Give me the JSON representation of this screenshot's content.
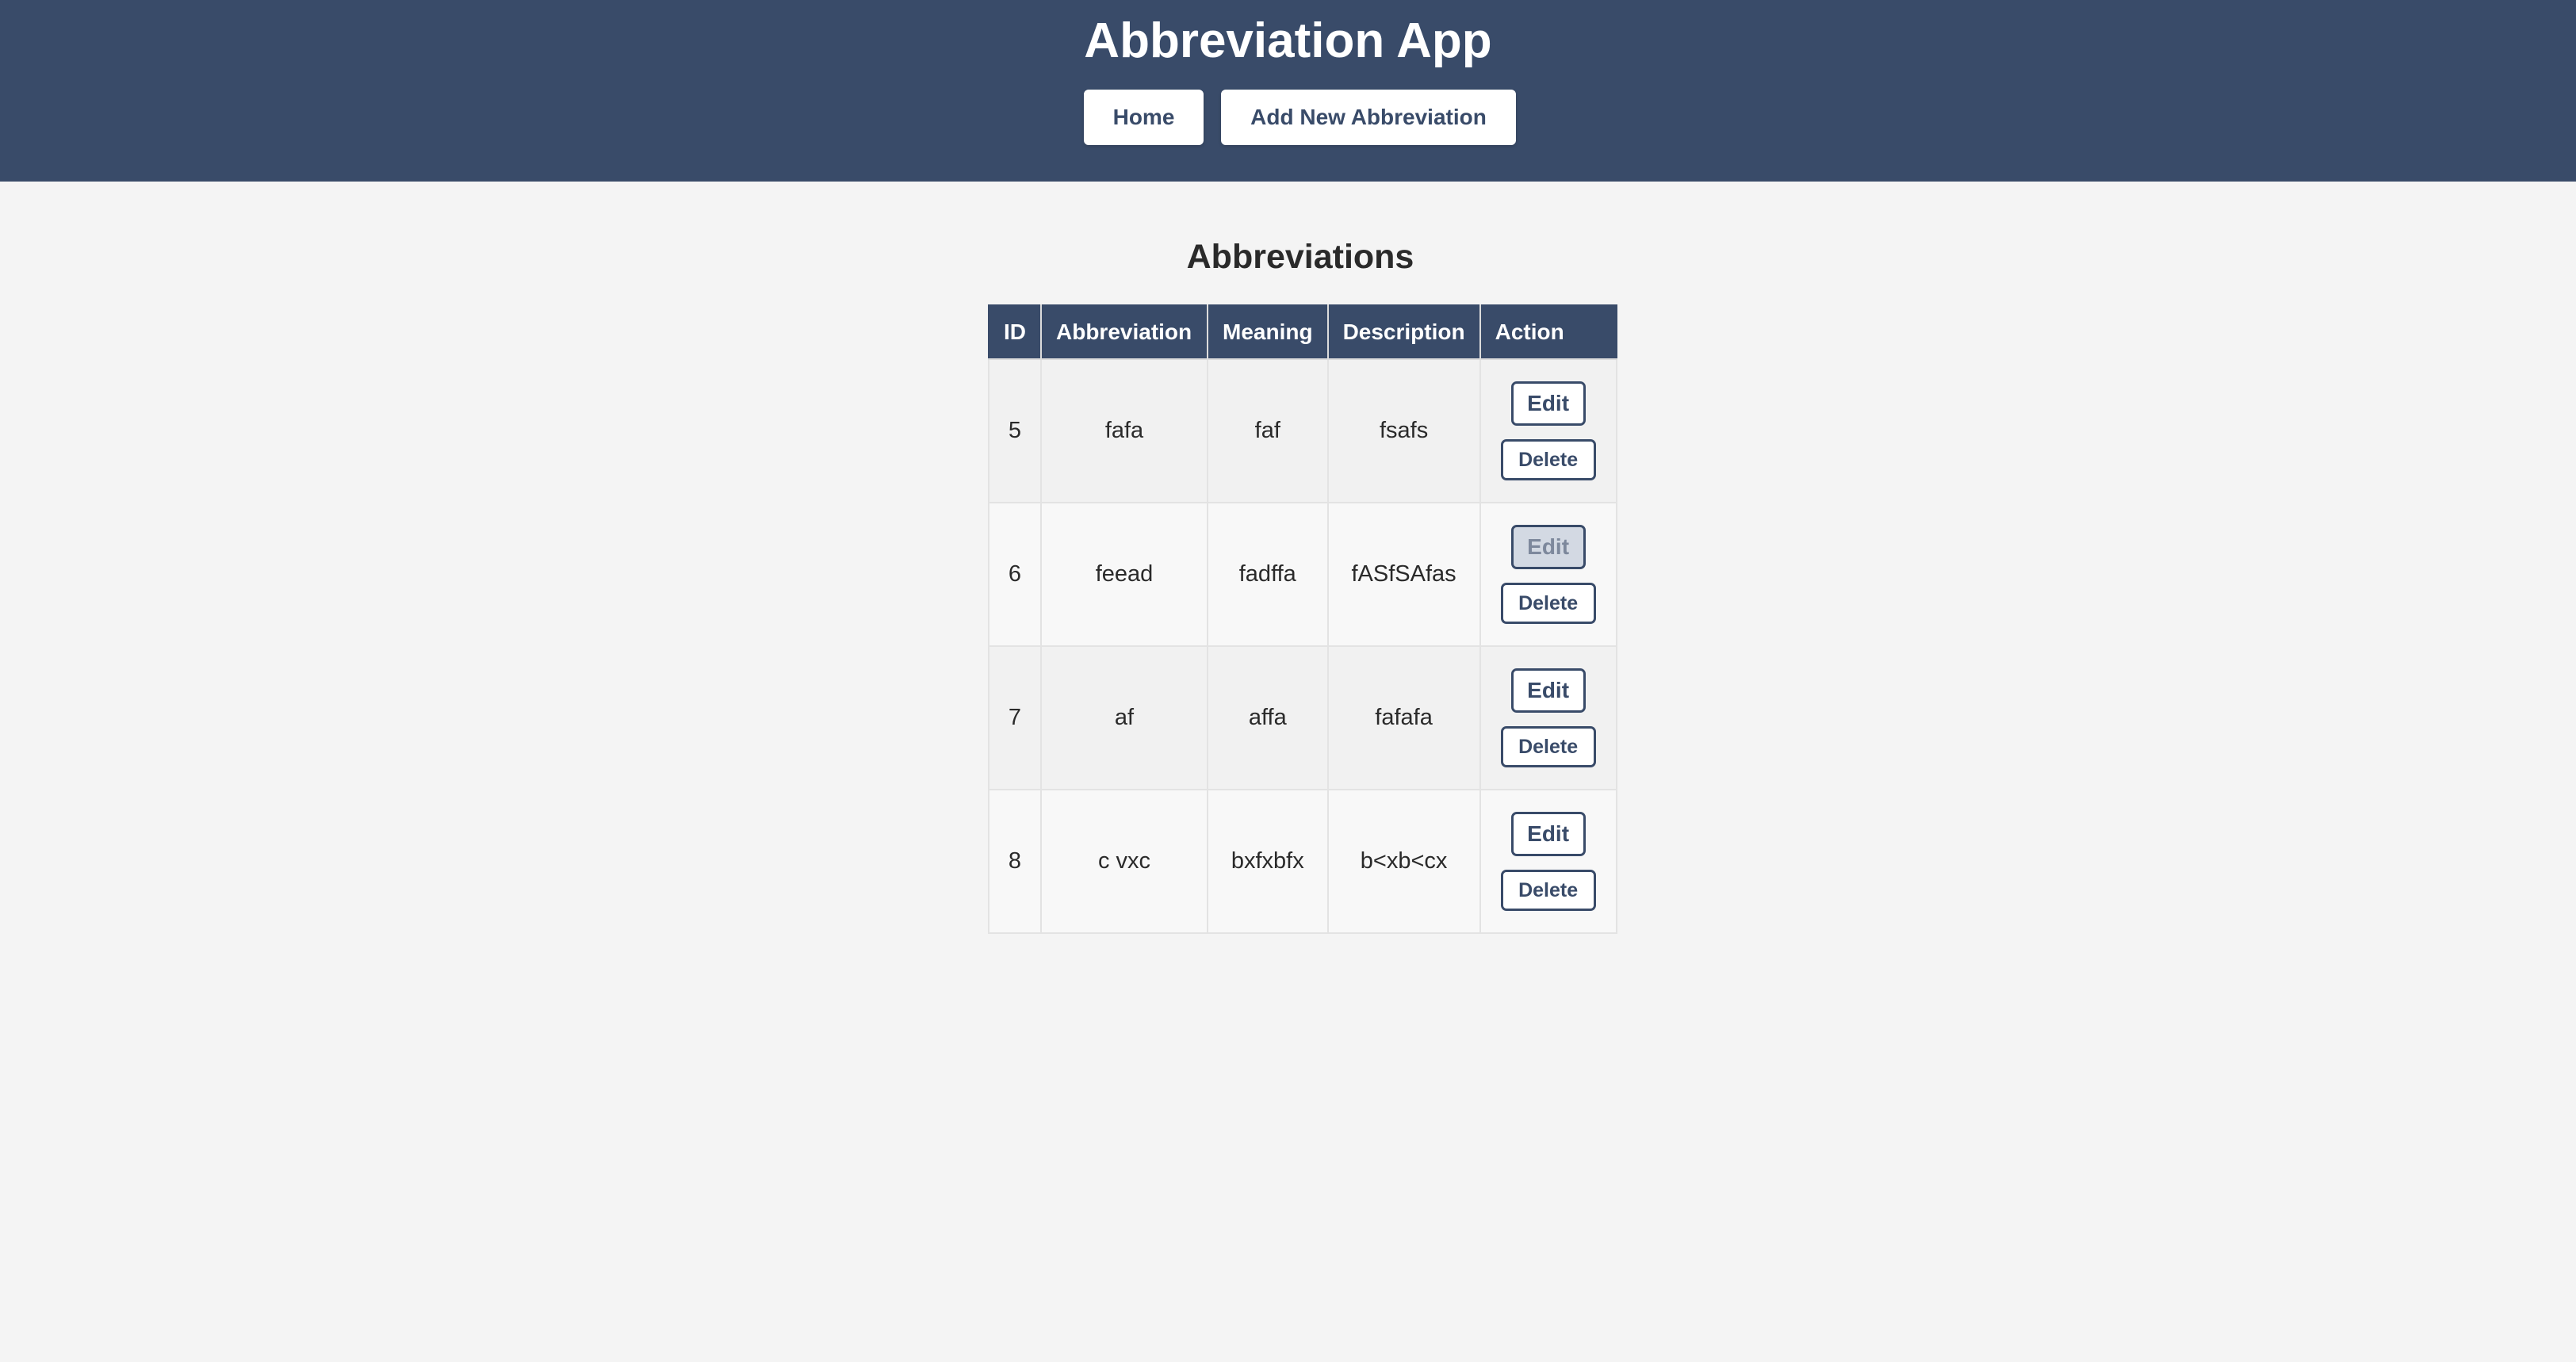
{
  "header": {
    "title": "Abbreviation App",
    "nav": {
      "home_label": "Home",
      "add_label": "Add New Abbreviation"
    }
  },
  "main": {
    "section_title": "Abbreviations",
    "table": {
      "columns": [
        "ID",
        "Abbreviation",
        "Meaning",
        "Description",
        "Action"
      ],
      "rows": [
        {
          "id": "5",
          "abbreviation": "fafa",
          "meaning": "faf",
          "description": "fsafs",
          "edit_label": "Edit",
          "delete_label": "Delete"
        },
        {
          "id": "6",
          "abbreviation": "feead",
          "meaning": "fadffa",
          "description": "fASfSAfas",
          "edit_label": "Edit",
          "delete_label": "Delete"
        },
        {
          "id": "7",
          "abbreviation": "af",
          "meaning": "affa",
          "description": "fafafa",
          "edit_label": "Edit",
          "delete_label": "Delete"
        },
        {
          "id": "8",
          "abbreviation": "c vxc",
          "meaning": "bxfxbfx",
          "description": "b<xb<cx",
          "edit_label": "Edit",
          "delete_label": "Delete"
        }
      ]
    }
  },
  "colors": {
    "header_bg": "#394b69",
    "page_bg": "#f4f4f4",
    "button_text": "#394b69",
    "hover_bg": "#d3d9e3"
  },
  "state": {
    "hovered_button": "row-6-edit"
  }
}
